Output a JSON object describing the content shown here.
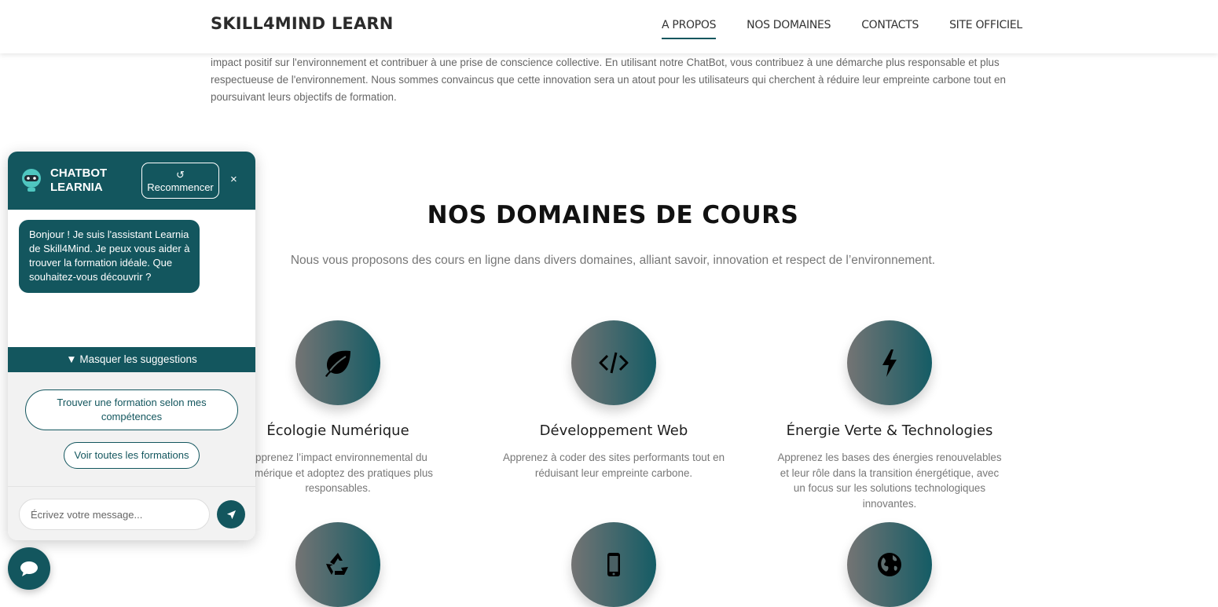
{
  "header": {
    "brand": "SKILL4MIND LEARN",
    "nav": [
      "A PROPOS",
      "NOS DOMAINES",
      "CONTACTS",
      "SITE OFFICIEL"
    ]
  },
  "intro": {
    "text": "impact positif sur l'environnement et contribuer à une prise de conscience collective. En utilisant notre ChatBot, vous contribuez à une démarche plus responsable et plus respectueuse de l'environnement. Nous sommes convaincus que cette innovation sera un atout pour les utilisateurs qui cherchent à réduire leur empreinte carbone tout en poursuivant leurs objectifs de formation."
  },
  "domains": {
    "title": "NOS DOMAINES DE COURS",
    "subtitle": "Nous vous proposons des cours en ligne dans divers domaines, alliant savoir, innovation et respect de l’environnement.",
    "cards": [
      {
        "icon": "leaf-icon",
        "title": "Écologie Numérique",
        "desc": "Apprenez l’impact environnemental du numérique et adoptez des pratiques plus responsables."
      },
      {
        "icon": "code-icon",
        "title": "Développement Web",
        "desc": "Apprenez à coder des sites performants tout en réduisant leur empreinte carbone."
      },
      {
        "icon": "bolt-icon",
        "title": "Énergie Verte & Technologies",
        "desc": "Apprenez les bases des énergies renouvelables et leur rôle dans la transition énergétique, avec un focus sur les solutions technologiques innovantes."
      },
      {
        "icon": "recycle-icon"
      },
      {
        "icon": "mobile-icon"
      },
      {
        "icon": "globe-icon"
      }
    ]
  },
  "chatbot": {
    "title_line1": "CHATBOT",
    "title_line2": "LEARNIA",
    "restart_icon": "↺",
    "restart_label": "Recommencer",
    "close_label": "×",
    "greeting": "Bonjour ! Je suis l'assistant Learnia de Skill4Mind. Je peux vous aider à trouver la formation idéale. Que souhaitez-vous découvrir ?",
    "toggle_suggestions": "▼ Masquer les suggestions",
    "suggestions": [
      "Trouver une formation selon mes compétences",
      "Voir toutes les formations"
    ],
    "input_placeholder": "Écrivez votre message..."
  },
  "colors": {
    "accent": "#13565e",
    "gradient_start": "#747474"
  }
}
